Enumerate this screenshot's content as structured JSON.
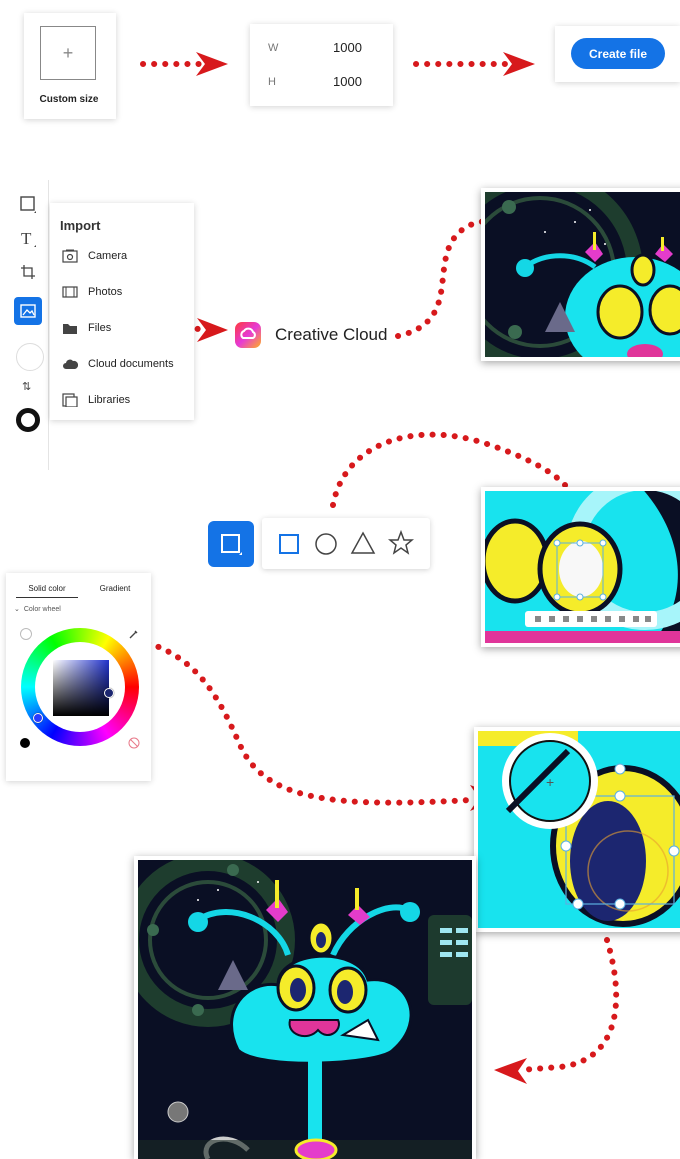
{
  "custom_size": {
    "label": "Custom size",
    "plus": "+"
  },
  "dimensions": {
    "w_label": "W",
    "w_value": "1000",
    "h_label": "H",
    "h_value": "1000"
  },
  "create_file": {
    "label": "Create file"
  },
  "import_menu": {
    "title": "Import",
    "items": [
      {
        "label": "Camera",
        "icon": "camera-icon"
      },
      {
        "label": "Photos",
        "icon": "photos-icon"
      },
      {
        "label": "Files",
        "icon": "folder-icon"
      },
      {
        "label": "Cloud documents",
        "icon": "cloud-icon"
      },
      {
        "label": "Libraries",
        "icon": "libraries-icon"
      }
    ]
  },
  "creative_cloud": {
    "label": "Creative Cloud"
  },
  "color_panel": {
    "tabs": [
      "Solid color",
      "Gradient"
    ],
    "mode_label": "Color wheel",
    "collapse_icon": "chevron-down-icon"
  },
  "colors": {
    "accent": "#1473e6",
    "arrow": "#d7191c"
  }
}
